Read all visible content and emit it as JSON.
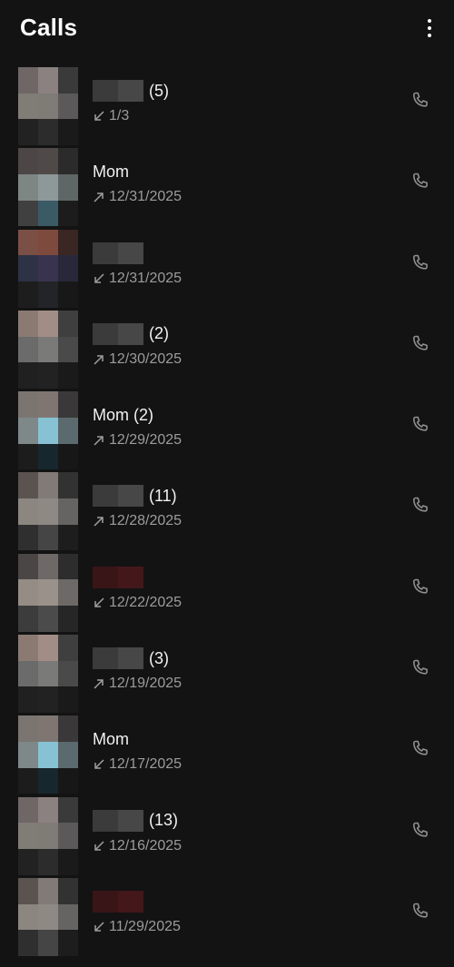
{
  "header": {
    "title": "Calls",
    "menu_icon": "more-vert-icon"
  },
  "calls": [
    {
      "name": "",
      "count": "(5)",
      "redacted": "grey",
      "direction": "incoming",
      "date": "1/3",
      "avatar": [
        "#6f6666",
        "#8c8181",
        "#3a3a3a",
        "#807c76",
        "#7f7b76",
        "#5b5959",
        "#222222",
        "#2c2c2c",
        "#1a1a1a"
      ]
    },
    {
      "name": "Mom",
      "count": "",
      "redacted": "none",
      "direction": "outgoing",
      "date": "12/31/2025",
      "avatar": [
        "#4c4646",
        "#4f4a48",
        "#2b2b2b",
        "#7e8684",
        "#8d9899",
        "#5e6666",
        "#404040",
        "#3a5a66",
        "#1c1c1c"
      ]
    },
    {
      "name": "",
      "count": "",
      "redacted": "grey",
      "direction": "incoming",
      "date": "12/31/2025",
      "avatar": [
        "#7a4f45",
        "#7e4a3e",
        "#3a2622",
        "#2e3245",
        "#393350",
        "#27293a",
        "#1d1d1d",
        "#232427",
        "#181818"
      ]
    },
    {
      "name": "",
      "count": "(2)",
      "redacted": "grey",
      "direction": "outgoing",
      "date": "12/30/2025",
      "avatar": [
        "#8a7a72",
        "#a28d86",
        "#3f3f3f",
        "#6b6b6b",
        "#7a7a78",
        "#4a4a4a",
        "#202020",
        "#222222",
        "#1a1a1a"
      ]
    },
    {
      "name": "Mom",
      "count": "(2)",
      "redacted": "none",
      "direction": "outgoing",
      "date": "12/29/2025",
      "avatar": [
        "#7b7571",
        "#7f7672",
        "#3a3838",
        "#7e8888",
        "#86c2d4",
        "#5b6a6e",
        "#1c1c1c",
        "#18272d",
        "#171717"
      ]
    },
    {
      "name": "",
      "count": "(11)",
      "redacted": "grey",
      "direction": "outgoing",
      "date": "12/28/2025",
      "avatar": [
        "#5a5350",
        "#827a76",
        "#323232",
        "#8c8680",
        "#8f8985",
        "#666462",
        "#2f2f2f",
        "#454545",
        "#1d1d1d"
      ]
    },
    {
      "name": "",
      "count": "",
      "redacted": "red",
      "direction": "incoming",
      "date": "12/22/2025",
      "avatar": [
        "#4a4646",
        "#6e6866",
        "#2d2d2d",
        "#958c86",
        "#9a918b",
        "#6c6966",
        "#3c3c3c",
        "#4b4b4b",
        "#262626"
      ]
    },
    {
      "name": "",
      "count": "(3)",
      "redacted": "grey",
      "direction": "outgoing",
      "date": "12/19/2025",
      "avatar": [
        "#8a7a72",
        "#a28d86",
        "#3f3f3f",
        "#6b6b6b",
        "#7a7a78",
        "#4a4a4a",
        "#202020",
        "#222222",
        "#1a1a1a"
      ]
    },
    {
      "name": "Mom",
      "count": "",
      "redacted": "none",
      "direction": "incoming",
      "date": "12/17/2025",
      "avatar": [
        "#7b7571",
        "#7f7672",
        "#3a3838",
        "#7e8888",
        "#86c2d4",
        "#5b6a6e",
        "#1c1c1c",
        "#18272d",
        "#171717"
      ]
    },
    {
      "name": "",
      "count": "(13)",
      "redacted": "grey",
      "direction": "incoming",
      "date": "12/16/2025",
      "avatar": [
        "#6f6666",
        "#8c8181",
        "#3a3a3a",
        "#807c76",
        "#7f7b76",
        "#5b5959",
        "#222222",
        "#2c2c2c",
        "#1a1a1a"
      ]
    },
    {
      "name": "",
      "count": "",
      "redacted": "red",
      "direction": "incoming",
      "date": "11/29/2025",
      "avatar": [
        "#5a5350",
        "#827a76",
        "#323232",
        "#8c8680",
        "#8f8985",
        "#666462",
        "#2f2f2f",
        "#454545",
        "#1d1d1d"
      ]
    }
  ],
  "icons": {
    "call": "phone-icon",
    "incoming": "call-received-icon",
    "outgoing": "call-made-icon"
  },
  "colors": {
    "background": "#131313",
    "secondary_text": "#9c9c9c",
    "icon": "#8f8f8f"
  }
}
